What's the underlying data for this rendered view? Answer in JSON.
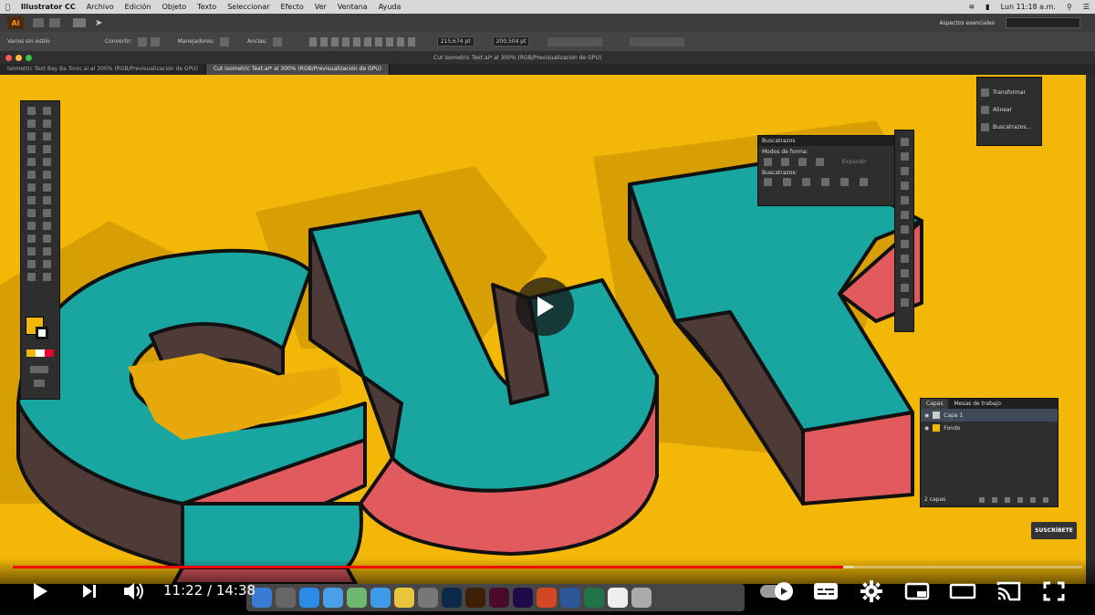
{
  "menubar": {
    "apple": "",
    "items": [
      "Illustrator CC",
      "Archivo",
      "Edición",
      "Objeto",
      "Texto",
      "Seleccionar",
      "Efecto",
      "Ver",
      "Ventana",
      "Ayuda"
    ],
    "clock": "Lun 11:18 a.m."
  },
  "appbar": {
    "app_icon_label": "Ai",
    "workspace": "Aspectos esenciales"
  },
  "ctrlbar": {
    "selection_label": "Varios sin estilo",
    "anchor_label": "Convertir:",
    "handles_label": "Manejadores:",
    "anchors_label": "Anclas:",
    "x_value": "215,674 pt",
    "y_value": "200,504 pt"
  },
  "document": {
    "title": "Cut isometric Text.ai* al 300% (RGB/Previsualización de GPU)",
    "tabs": [
      {
        "label": "Isometric Text Bay Ba Tonic.ai al 300% (RGB/Previsualización de GPU)",
        "active": false
      },
      {
        "label": "Cut isometric Text.ai* al 300% (RGB/Previsualización de GPU)",
        "active": true
      }
    ]
  },
  "artwork": {
    "text": "CUT",
    "colors": {
      "background": "#f2b707",
      "shadow": "#d89f05",
      "face": "#1aa6a0",
      "side_dark": "#4e3a37",
      "side_red": "#e05a5e",
      "outline": "#111111"
    }
  },
  "pathfinder_panel": {
    "title": "Buscatrazos",
    "section1": "Modos de forma:",
    "expand": "Expandir",
    "section2": "Buscatrazos:"
  },
  "transform_panel": {
    "items": [
      "Transformar",
      "Alinear",
      "Buscatrazos..."
    ]
  },
  "layers_panel": {
    "tabs": [
      "Capas",
      "Mesas de trabajo"
    ],
    "layers": [
      "Capa 1",
      "Fondo"
    ],
    "footer": "2 capas"
  },
  "player": {
    "current_time": "11:22",
    "separator": " / ",
    "duration": "14:38",
    "progress": 0.7767,
    "buffered": 0.787,
    "subscribe": "SUSCRÍBETE",
    "colors": {
      "progress": "#ff0000",
      "controls": "#ffffff"
    }
  }
}
